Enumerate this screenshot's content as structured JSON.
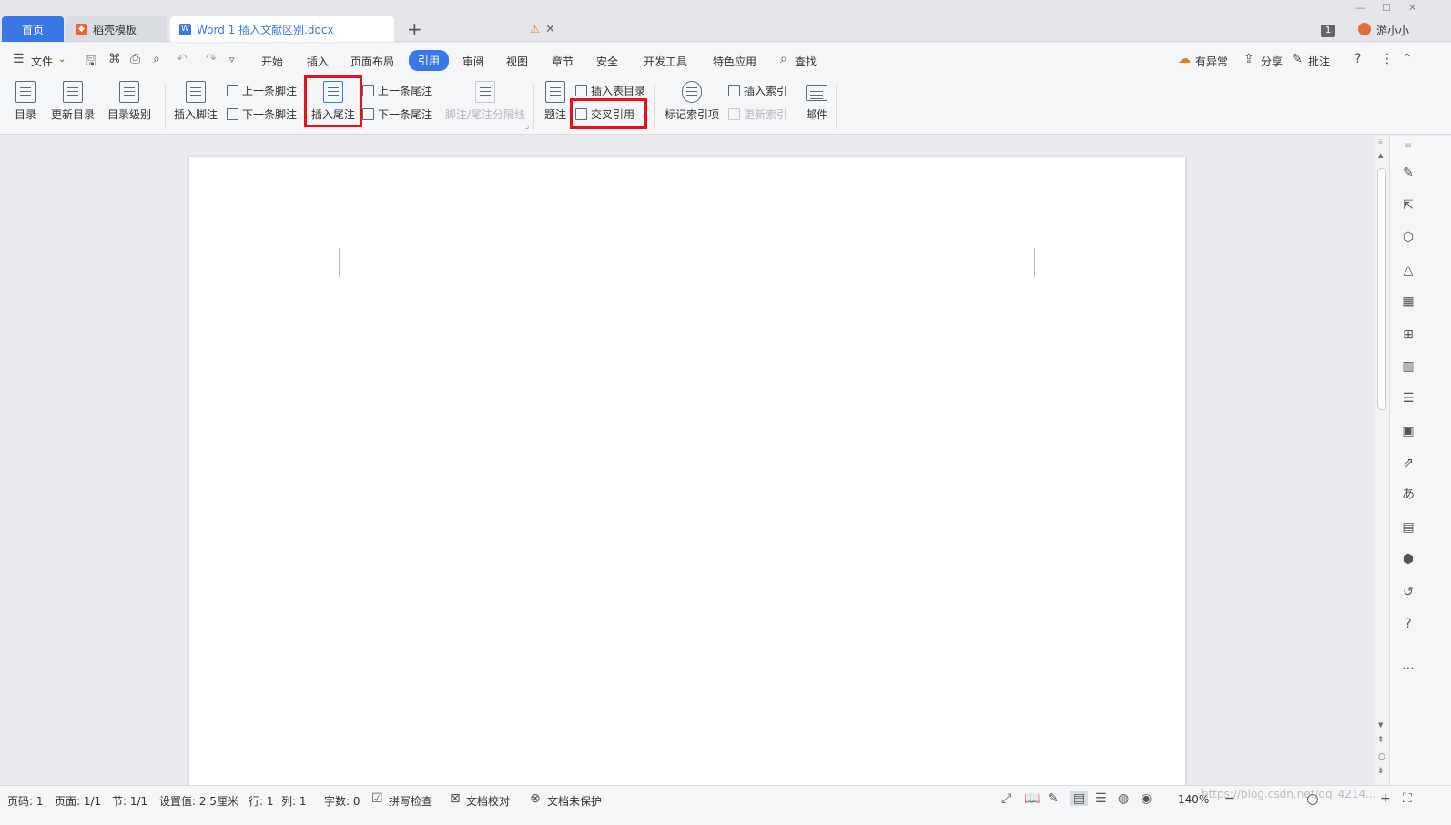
{
  "tabs": {
    "home": "首页",
    "template": "稻壳模板",
    "document": "Word 1 插入文献区别.docx",
    "add": "+",
    "doc_count": "1",
    "user": "游小小"
  },
  "menu": {
    "file": "文件",
    "items": [
      "开始",
      "插入",
      "页面布局",
      "引用",
      "审阅",
      "视图",
      "章节",
      "安全",
      "开发工具",
      "特色应用"
    ],
    "active": "引用",
    "search": "查找",
    "right": [
      "有异常",
      "分享",
      "批注"
    ]
  },
  "ribbon": {
    "toc": "目录",
    "update_toc": "更新目录",
    "toc_level": "目录级别",
    "insert_footnote": "插入脚注",
    "prev_footnote": "上一条脚注",
    "next_footnote": "下一条脚注",
    "insert_endnote": "插入尾注",
    "prev_endnote": "上一条尾注",
    "next_endnote": "下一条尾注",
    "separator": "脚注/尾注分隔线",
    "caption": "题注",
    "insert_table_toc": "插入表目录",
    "cross_reference": "交叉引用",
    "mark_index": "标记索引项",
    "insert_index": "插入索引",
    "update_index": "更新索引",
    "mail": "邮件"
  },
  "status": {
    "page_num": "页码: 1",
    "page": "页面: 1/1",
    "section": "节: 1/1",
    "setting": "设置值: 2.5厘米",
    "row": "行: 1",
    "col": "列: 1",
    "words": "字数: 0",
    "spell": "拼写检查",
    "proof": "文档校对",
    "protect": "文档未保护",
    "zoom": "140%",
    "zoom_level_percent": 140
  },
  "watermark": "https://blog.csdn.net/qq_4214..."
}
